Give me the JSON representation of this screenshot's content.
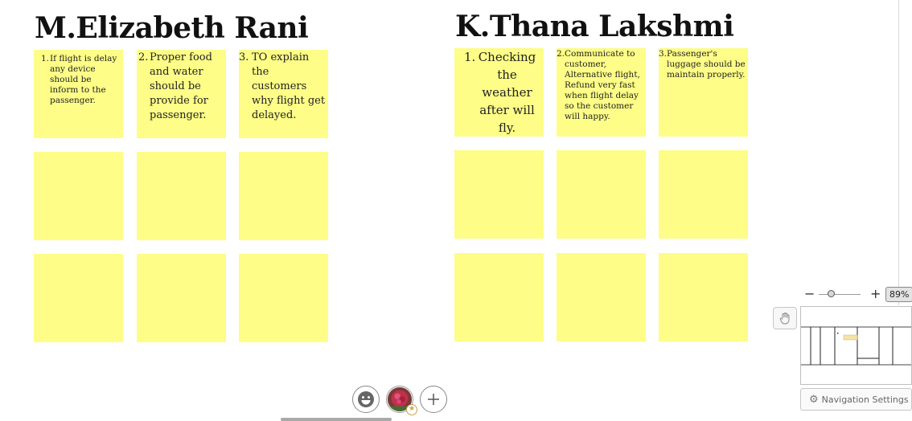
{
  "persons": [
    {
      "name": "M.Elizabeth Rani",
      "notes": [
        {
          "num": "1.",
          "text": "If flight is delay any device should be inform to the passenger."
        },
        {
          "num": "2.",
          "text": "Proper food and water should be provide for passenger."
        },
        {
          "num": "3.",
          "text": "TO explain the customers why flight get delayed."
        }
      ]
    },
    {
      "name": "K.Thana Lakshmi",
      "notes": [
        {
          "num": "1.",
          "text": "Checking the weather after will fly."
        },
        {
          "num": "2.",
          "text": "Communicate to customer, Alternative flight, Refund very fast when flight delay so  the customer will happy."
        },
        {
          "num": "3.",
          "text": "Passenger's luggage should be maintain properly."
        }
      ]
    }
  ],
  "zoom": {
    "minus": "−",
    "plus": "+",
    "value": "89%",
    "level_fraction": 0.25
  },
  "navigation": {
    "settings_label": "Navigation Settings",
    "icon": "gear-icon"
  },
  "bottom_toolbar": {
    "icons": [
      "emoji-icon",
      "user-avatar",
      "add-icon"
    ]
  },
  "colors": {
    "sticky_note": "#fdfd87",
    "minimap_highlight": "#f6e3a3"
  }
}
